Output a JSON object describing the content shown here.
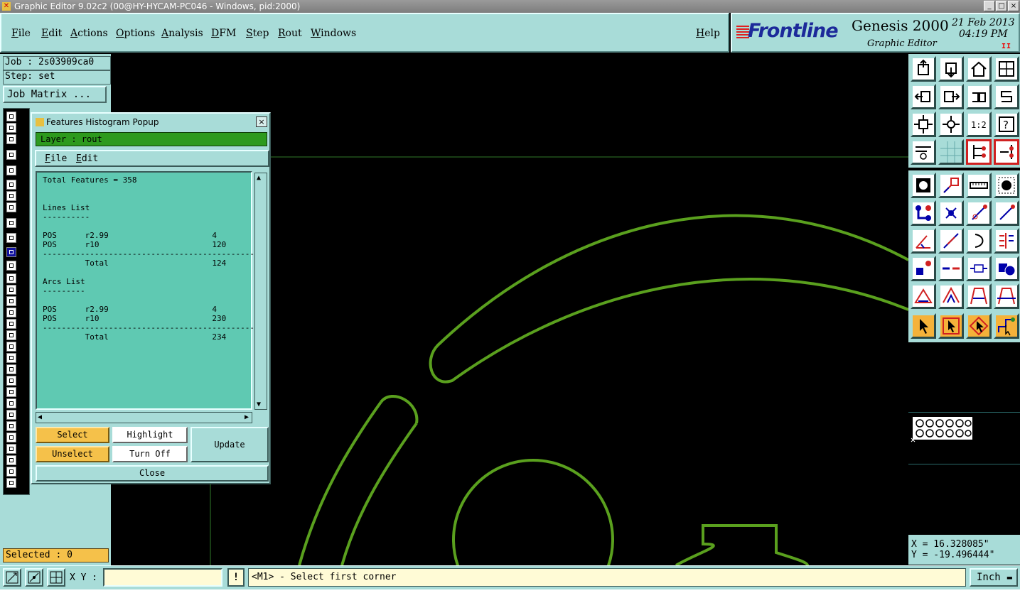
{
  "window": {
    "title": "Graphic Editor 9.02c2 (00@HY-HYCAM-PC046 - Windows, pid:2000)",
    "btn_min": "_",
    "btn_max": "□",
    "btn_close": "×"
  },
  "menu": {
    "items": [
      "File",
      "Edit",
      "Actions",
      "Options",
      "Analysis",
      "DFM",
      "Step",
      "Rout",
      "Windows"
    ],
    "help": "Help"
  },
  "brand": {
    "logo": "Frontline",
    "product": "Genesis 2000",
    "subtitle": "Graphic Editor",
    "date": "21 Feb 2013",
    "time": "04:19 PM",
    "pause": "II"
  },
  "left": {
    "job": "Job : 2s03909ca0",
    "step": "Step: set",
    "job_matrix": "Job Matrix ...",
    "selected": "Selected : 0"
  },
  "popup": {
    "title": "Features Histogram Popup",
    "close": "×",
    "layer": "Layer :  rout",
    "menu": [
      "File",
      "Edit"
    ],
    "text_lines": [
      "Total Features = 358",
      "",
      "",
      "Lines List",
      "----------",
      "",
      "POS      r2.99                      4",
      "POS      r10                        120",
      "---------------------------------------------",
      "         Total                      124",
      "",
      "Arcs List",
      "---------",
      "",
      "POS      r2.99                      4",
      "POS      r10                        230",
      "---------------------------------------------",
      "         Total                      234"
    ],
    "buttons": {
      "select": "Select",
      "highlight": "Highlight",
      "update": "Update",
      "unselect": "Unselect",
      "turn_off": "Turn Off",
      "close": "Close"
    }
  },
  "coords": {
    "x": "X = 16.328085\"",
    "y": "Y = -19.496444\""
  },
  "bottom": {
    "xy_label": "X Y :",
    "xy_value": "",
    "excl": "!",
    "prompt": "<M1> - Select first corner",
    "units": "Inch"
  },
  "colors": {
    "panel": "#a8dcd8",
    "feature_green": "#5aa01e",
    "highlight_orange": "#f5c14a"
  }
}
